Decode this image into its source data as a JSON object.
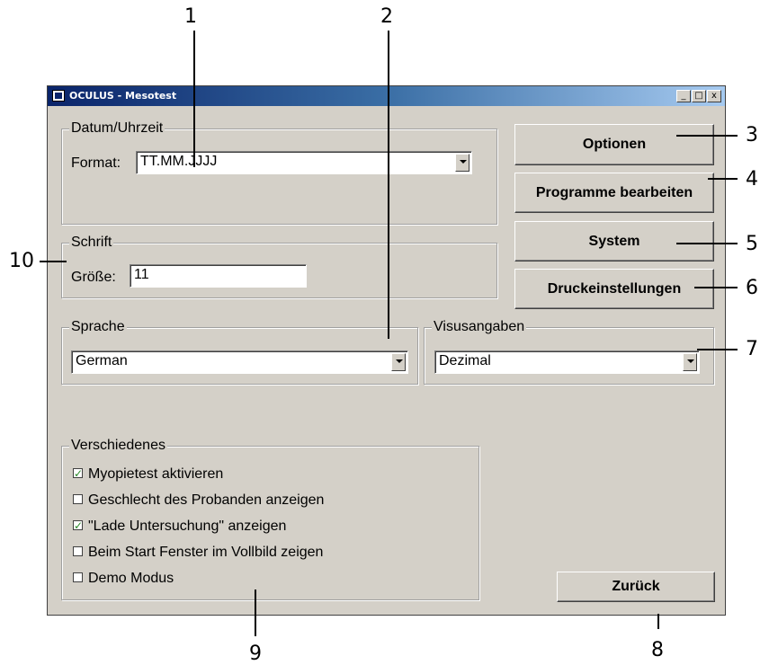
{
  "callouts": [
    "1",
    "2",
    "3",
    "4",
    "5",
    "6",
    "7",
    "8",
    "9",
    "10"
  ],
  "window": {
    "title": "OCULUS - Mesotest",
    "controls": {
      "minimize": "_",
      "maximize": "□",
      "close": "x"
    }
  },
  "datum": {
    "group_title": "Datum/Uhrzeit",
    "format_label": "Format:",
    "format_value": "TT.MM.JJJJ"
  },
  "schrift": {
    "group_title": "Schrift",
    "size_label": "Größe:",
    "size_value": "11"
  },
  "sprache": {
    "group_title": "Sprache",
    "value": "German"
  },
  "visus": {
    "group_title": "Visusangaben",
    "value": "Dezimal"
  },
  "buttons": {
    "optionen": "Optionen",
    "programme": "Programme bearbeiten",
    "system": "System",
    "druck": "Druckeinstellungen",
    "zurueck": "Zurück"
  },
  "verschiedenes": {
    "group_title": "Verschiedenes",
    "items": [
      {
        "label": "Myopietest aktivieren",
        "checked": true
      },
      {
        "label": "Geschlecht des Probanden anzeigen",
        "checked": false
      },
      {
        "label": "\"Lade Untersuchung\" anzeigen",
        "checked": true
      },
      {
        "label": "Beim Start Fenster im Vollbild zeigen",
        "checked": false
      },
      {
        "label": "Demo Modus",
        "checked": false
      }
    ]
  }
}
